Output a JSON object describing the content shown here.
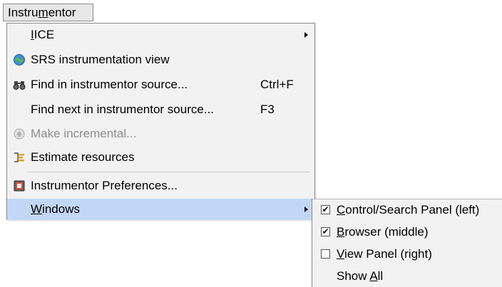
{
  "menubar": {
    "label_pre": "Instru",
    "label_mnemonic": "m",
    "label_post": "entor"
  },
  "menu": {
    "items": [
      {
        "name": "iice",
        "mn": "I",
        "rest": "ICE",
        "has_submenu": true
      },
      {
        "name": "srs-view",
        "label": "SRS instrumentation view",
        "icon": "globe-icon"
      },
      {
        "name": "find-source",
        "label": "Find in instrumentor source...",
        "shortcut": "Ctrl+F",
        "icon": "binoculars-icon"
      },
      {
        "name": "find-next",
        "label": "Find next in instrumentor source...",
        "shortcut": "F3"
      },
      {
        "name": "make-incremental",
        "label": "Make incremental...",
        "disabled": true,
        "icon": "increment-icon"
      },
      {
        "name": "estimate-resources",
        "label": "Estimate resources",
        "icon": "estimate-icon"
      },
      {
        "name": "preferences",
        "label": "Instrumentor Preferences...",
        "icon": "preferences-icon"
      },
      {
        "name": "windows",
        "mn": "W",
        "rest": "indows",
        "has_submenu": true,
        "highlighted": true
      }
    ]
  },
  "submenu": {
    "items": [
      {
        "checked": true,
        "mn": "C",
        "rest": "ontrol/Search Panel (left)"
      },
      {
        "checked": true,
        "mn": "B",
        "rest": "rowser (middle)"
      },
      {
        "checked": false,
        "mn": "V",
        "rest": "iew Panel (right)"
      },
      {
        "pre": "Show ",
        "mn": "A",
        "rest": "ll"
      }
    ]
  },
  "colors": {
    "menu_bg": "#f2f2f2",
    "highlight": "#c2d7f5",
    "disabled_text": "#8d8d8d"
  }
}
